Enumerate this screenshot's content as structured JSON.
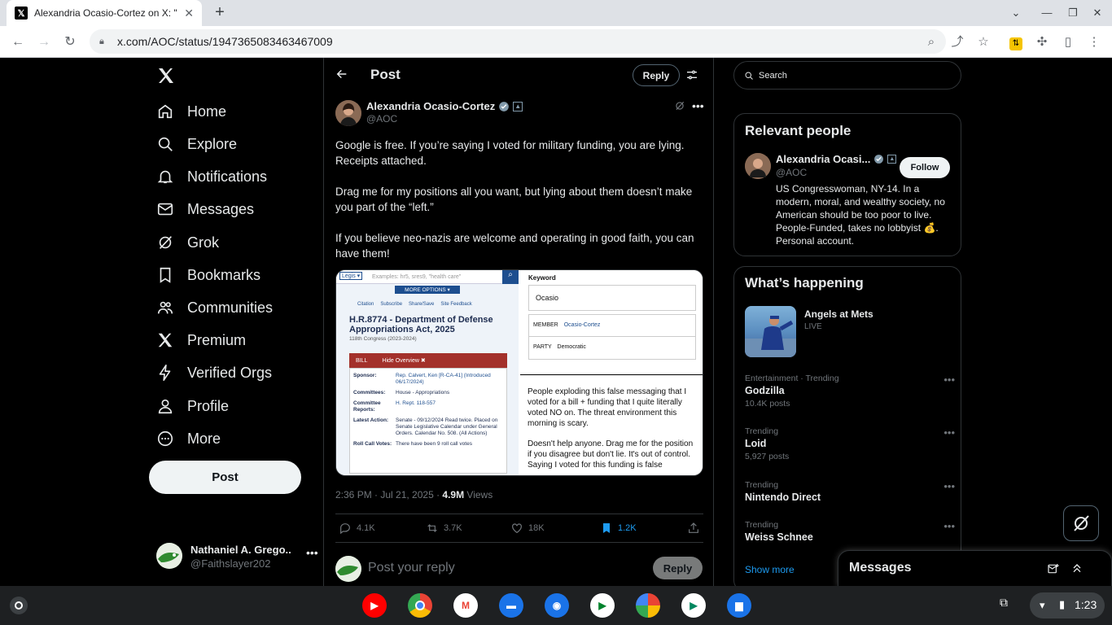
{
  "browser": {
    "tab_title": "Alexandria Ocasio-Cortez on X: \"",
    "url": "x.com/AOC/status/1947365083463467009"
  },
  "left_nav": {
    "items": [
      {
        "label": "Home",
        "icon": "home-icon"
      },
      {
        "label": "Explore",
        "icon": "search-icon"
      },
      {
        "label": "Notifications",
        "icon": "bell-icon"
      },
      {
        "label": "Messages",
        "icon": "envelope-icon"
      },
      {
        "label": "Grok",
        "icon": "grok-icon"
      },
      {
        "label": "Bookmarks",
        "icon": "bookmark-icon"
      },
      {
        "label": "Communities",
        "icon": "people-icon"
      },
      {
        "label": "Premium",
        "icon": "x-icon"
      },
      {
        "label": "Verified Orgs",
        "icon": "lightning-icon"
      },
      {
        "label": "Profile",
        "icon": "person-icon"
      },
      {
        "label": "More",
        "icon": "more-circle-icon"
      }
    ],
    "post_button": "Post",
    "account": {
      "name": "Nathaniel A. Grego...",
      "handle": "@Faithslayer202"
    }
  },
  "post": {
    "header_title": "Post",
    "header_reply": "Reply",
    "author_name": "Alexandria Ocasio-Cortez",
    "author_handle": "@AOC",
    "paragraphs": [
      "Google is free. If you’re saying I voted for military funding, you are lying. Receipts attached.",
      "Drag me for my positions all you want, but lying about them doesn’t make you part of the “left.”",
      "If you believe neo-nazis are welcome and operating in good faith, you can have them!"
    ],
    "media": {
      "left": {
        "search_placeholder": "Examples: hr5, sres9, \"health care\"",
        "more_options": "MORE OPTIONS ▾",
        "links": [
          "Citation",
          "Subscribe",
          "Share/Save",
          "Site Feedback"
        ],
        "bill_title": "H.R.8774 - Department of Defense Appropriations Act, 2025",
        "congress": "118th Congress (2023-2024)",
        "bill_tab": "BILL",
        "hide_overview": "Hide Overview ✖",
        "rows": [
          {
            "k": "Sponsor:",
            "v": "Rep. Calvert, Ken [R-CA-41] (Introduced 06/17/2024)"
          },
          {
            "k": "Committees:",
            "v": "House - Appropriations"
          },
          {
            "k": "Committee Reports:",
            "v": "H. Rept. 118-557"
          },
          {
            "k": "Latest Action:",
            "v": "Senate - 09/12/2024 Read twice. Placed on Senate Legislative Calendar under General Orders. Calendar No. 508. (All Actions)"
          },
          {
            "k": "Roll Call Votes:",
            "v": "There have been 9 roll call votes"
          }
        ]
      },
      "keyword": {
        "label": "Keyword",
        "value": "Ocasio",
        "member_label": "MEMBER",
        "member_value": "Ocasio-Cortez",
        "party_label": "PARTY",
        "party_value": "Democratic"
      },
      "quote": {
        "p1": "People exploding this false messaging that I voted for a bill + funding that I quite literally voted NO on. The threat environment this morning is scary.",
        "p2": "Doesn't help anyone. Drag me for the position if you disagree but don't lie. It's out of control. Saying I voted for this funding is false"
      }
    },
    "timestamp": "2:36 PM · Jul 21, 2025 · ",
    "views_count": "4.9M",
    "views_label": " Views",
    "stats": {
      "replies": "4.1K",
      "reposts": "3.7K",
      "likes": "18K",
      "bookmarks": "1.2K"
    },
    "reply_placeholder": "Post your reply",
    "reply_button": "Reply"
  },
  "right": {
    "search_placeholder": "Search",
    "relevant_title": "Relevant people",
    "person": {
      "name": "Alexandria Ocasi...",
      "handle": "@AOC",
      "follow": "Follow",
      "bio": "US Congresswoman, NY-14. In a modern, moral, and wealthy society, no American should be too poor to live. People-Funded, takes no lobbyist 💰. Personal account."
    },
    "happening_title": "What’s happening",
    "event": {
      "name": "Angels at Mets",
      "status": "LIVE"
    },
    "trends": [
      {
        "category": "Entertainment · Trending",
        "name": "Godzilla",
        "count": "10.4K posts"
      },
      {
        "category": "Trending",
        "name": "Loid",
        "count": "5,927 posts"
      },
      {
        "category": "Trending",
        "name": "Nintendo Direct",
        "count": ""
      },
      {
        "category": "Trending",
        "name": "Weiss Schnee",
        "count": ""
      }
    ],
    "show_more": "Show more",
    "messages_title": "Messages"
  },
  "shelf": {
    "time": "1:23"
  },
  "colors": {
    "accent": "#1d9bf0",
    "bg": "#000000",
    "border": "#2f3336",
    "muted": "#71767b"
  }
}
